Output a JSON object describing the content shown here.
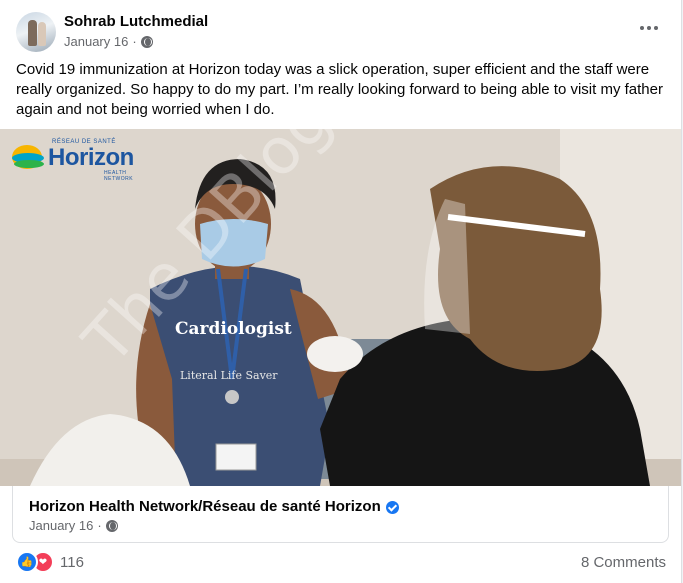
{
  "post": {
    "author": "Sohrab Lutchmedial",
    "date": "January 16",
    "separator": "·",
    "privacy_icon": "globe-icon",
    "caption": "Covid 19 immunization at Horizon today was a slick operation, super efficient and the staff were really organized. So happy to do my part. I’m really looking forward to being able to visit my father again and not being worried when I do."
  },
  "photo": {
    "logo_text": "Horizon",
    "logo_tagline_top": "RÉSEAU DE SANTÉ",
    "logo_tagline_bottom": "HEALTH NETWORK",
    "watermark": "The DBlog.com"
  },
  "link_card": {
    "title": "Horizon Health Network/Réseau de santé Horizon",
    "date": "January 16",
    "separator": "·",
    "verified_icon": "verified-badge-icon"
  },
  "footer": {
    "reaction_count": "116",
    "comments": "8 Comments"
  },
  "colors": {
    "accent": "#1877f2",
    "love": "#f33e58",
    "secondary_text": "#65676b"
  }
}
